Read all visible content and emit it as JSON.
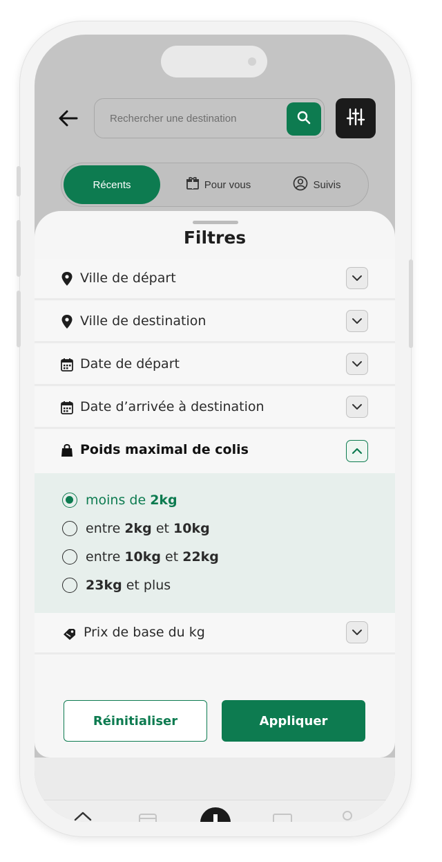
{
  "search": {
    "placeholder": "Rechercher une destination"
  },
  "tabs": [
    {
      "label": "Récents",
      "active": true
    },
    {
      "label": "Pour vous",
      "icon": "gift-box-icon"
    },
    {
      "label": "Suivis",
      "icon": "user-circle-icon"
    }
  ],
  "sheet": {
    "title": "Filtres",
    "filters": [
      {
        "label": "Ville de départ",
        "icon": "location-pin-icon"
      },
      {
        "label": "Ville de destination",
        "icon": "location-pin-icon"
      },
      {
        "label": "Date de départ",
        "icon": "calendar-icon"
      },
      {
        "label": "Date d’arrivée à destination",
        "icon": "calendar-icon"
      },
      {
        "label": "Poids maximal de colis",
        "icon": "bag-icon",
        "expanded": true
      },
      {
        "label": "Prix de base du kg",
        "icon": "price-tag-icon"
      }
    ],
    "weight_options": [
      {
        "parts": [
          "moins de ",
          "2kg"
        ],
        "selected": true
      },
      {
        "parts": [
          "entre ",
          "2kg",
          " et ",
          "10kg"
        ],
        "selected": false
      },
      {
        "parts": [
          "entre ",
          "10kg",
          " et ",
          "22kg"
        ],
        "selected": false
      },
      {
        "parts": [
          "23kg",
          " et plus"
        ],
        "selected": false
      }
    ],
    "reset_label": "Réinitialiser",
    "apply_label": "Appliquer"
  },
  "colors": {
    "accent": "#0d7b50",
    "dark_button": "#1b1b1b"
  }
}
